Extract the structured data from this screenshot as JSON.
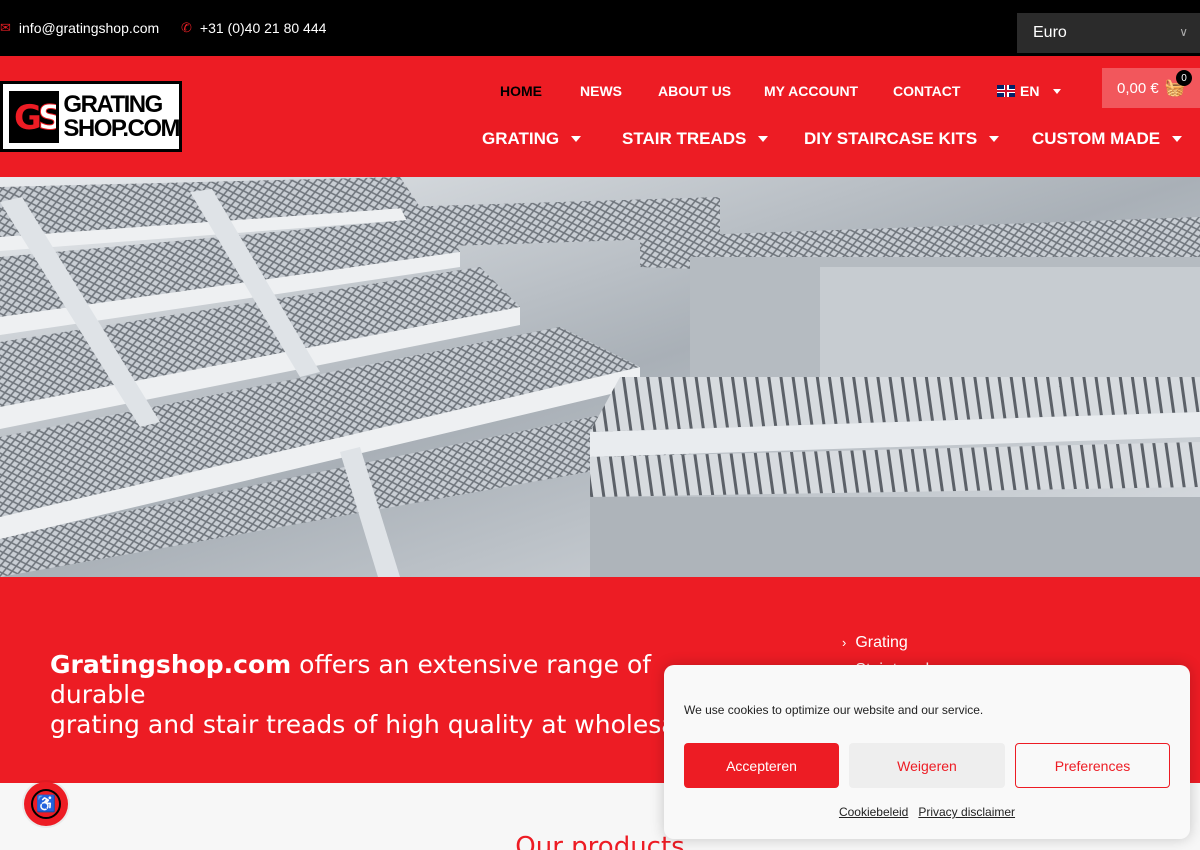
{
  "topbar": {
    "email": "info@gratingshop.com",
    "phone": "+31 (0)40 21 80 444",
    "currency": "Euro"
  },
  "header": {
    "logo_text_line1": "GRATING",
    "logo_text_line2": "SHOP.COM",
    "logo_mark": "GS",
    "nav_top": [
      "HOME",
      "NEWS",
      "ABOUT US",
      "MY ACCOUNT",
      "CONTACT"
    ],
    "language": "EN",
    "cart_total": "0,00 €",
    "cart_count": "0",
    "nav_main": [
      "GRATING",
      "STAIR TREADS",
      "DIY STAIRCASE KITS",
      "CUSTOM MADE"
    ]
  },
  "intro": {
    "brand": "Gratingshop.com",
    "text_line1": " offers an extensive range of durable",
    "text_line2": "grating and stair treads of high quality at wholesale"
  },
  "sidelist": [
    "Grating",
    "Stair treads"
  ],
  "products": {
    "heading": "Our products"
  },
  "cookie": {
    "message": "We use cookies to optimize our website and our service.",
    "accept": "Accepteren",
    "deny": "Weigeren",
    "preferences": "Preferences",
    "link_policy": "Cookiebeleid",
    "link_privacy": "Privacy disclaimer"
  },
  "colors": {
    "brand_red": "#ed1c24",
    "black": "#000000"
  }
}
